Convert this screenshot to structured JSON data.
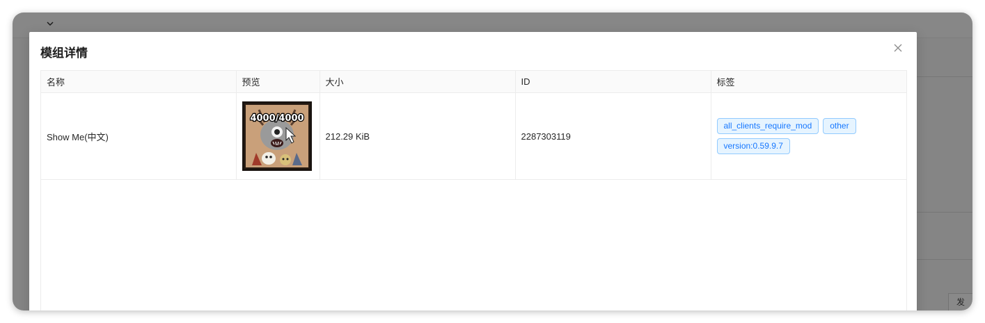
{
  "background": {
    "corner_button_label": "发"
  },
  "modal": {
    "title": "模组详情",
    "table": {
      "headers": [
        "名称",
        "预览",
        "大小",
        "ID",
        "标签"
      ],
      "rows": [
        {
          "name": "Show Me(中文)",
          "preview": {
            "icon": "mod-preview-image",
            "overlay_text": "4000/4000"
          },
          "size": "212.29 KiB",
          "id": "2287303119",
          "tags": [
            "all_clients_require_mod",
            "other",
            "version:0.59.9.7"
          ]
        }
      ]
    }
  },
  "colors": {
    "tag_text": "#1677ff",
    "tag_bg": "#e6f4ff",
    "tag_border": "#91caff",
    "overlay": "rgba(0,0,0,0.45)"
  }
}
